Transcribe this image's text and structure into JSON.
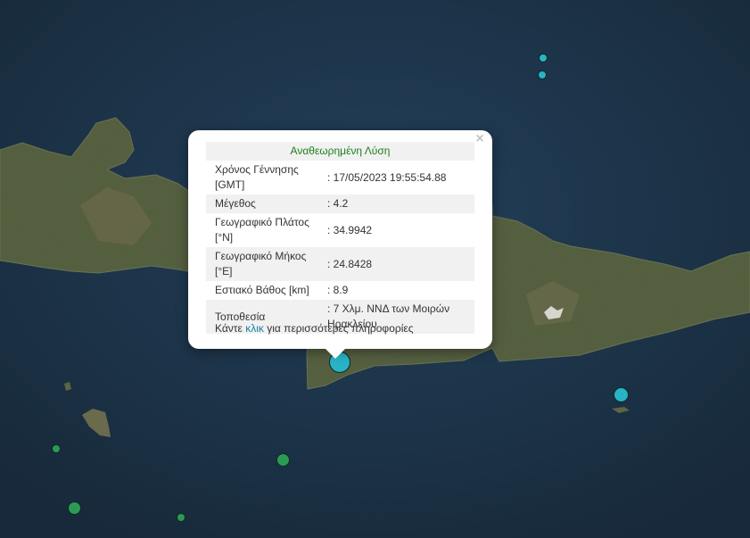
{
  "popup": {
    "title": "Αναθεωρημένη Λύση",
    "close_label": "×",
    "rows": [
      {
        "label": "Χρόνος Γέννησης [GMT]",
        "value": ": 17/05/2023 19:55:54.88"
      },
      {
        "label": "Μέγεθος",
        "value": ": 4.2"
      },
      {
        "label": "Γεωγραφικό Πλάτος [°N]",
        "value": ": 34.9942"
      },
      {
        "label": "Γεωγραφικό Μήκος [°E]",
        "value": ": 24.8428"
      },
      {
        "label": "Εστιακό Βάθος [km]",
        "value": ": 8.9"
      },
      {
        "label": "Τοποθεσία",
        "value": ": 7 Χλμ. ΝΝΔ των Μοιρών Ηρακλείου"
      }
    ],
    "more_prefix": "Κάντε ",
    "more_link": "κλικ",
    "more_suffix": " για περισσότερες πληροφορίες"
  },
  "colors": {
    "sea": "#1e3446",
    "land": "#4d5a36",
    "marker_cyan": "#29b3c6",
    "marker_green": "#2b9a55"
  },
  "markers": [
    {
      "name": "earthquake-marker-selected",
      "color": "cyan"
    },
    {
      "name": "earthquake-marker",
      "color": "cyan"
    },
    {
      "name": "earthquake-marker",
      "color": "cyan"
    },
    {
      "name": "earthquake-marker",
      "color": "cyan"
    },
    {
      "name": "earthquake-marker",
      "color": "green"
    },
    {
      "name": "earthquake-marker",
      "color": "green"
    },
    {
      "name": "earthquake-marker",
      "color": "green"
    },
    {
      "name": "earthquake-marker",
      "color": "green"
    }
  ]
}
